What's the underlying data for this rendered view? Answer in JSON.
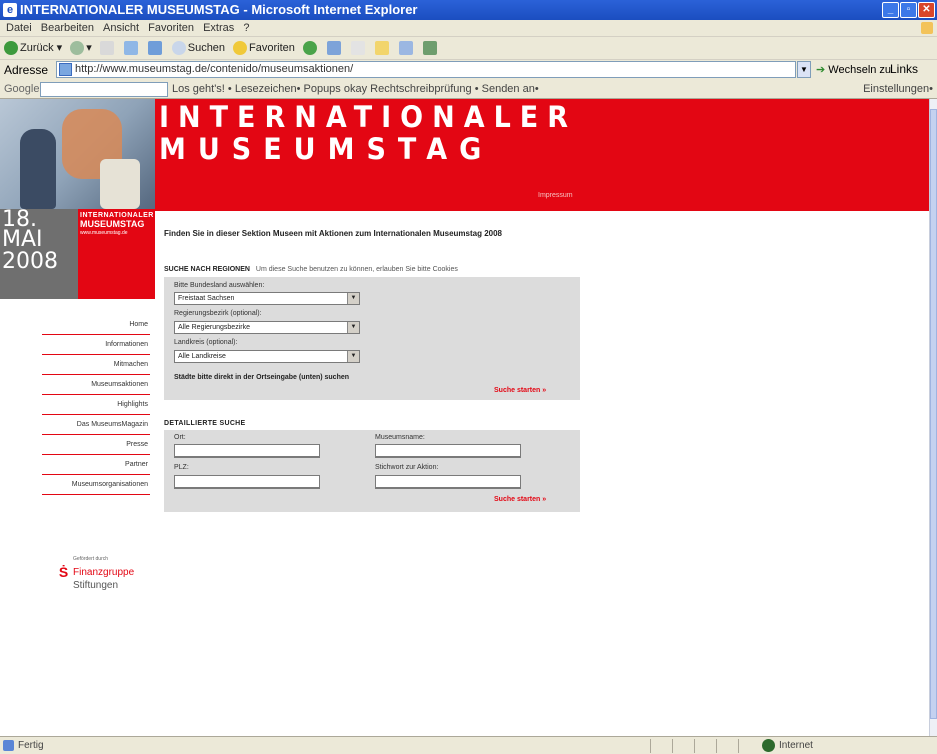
{
  "window": {
    "title": "INTERNATIONALER MUSEUMSTAG - Microsoft Internet Explorer",
    "buttons": [
      "_",
      "▫",
      "✕"
    ]
  },
  "menu": [
    "Datei",
    "Bearbeiten",
    "Ansicht",
    "Favoriten",
    "Extras",
    "?"
  ],
  "toolbar": {
    "back": "Zurück",
    "search": "Suchen",
    "favorites": "Favoriten"
  },
  "address": {
    "label": "Adresse",
    "url": "http://www.museumstag.de/contenido/museumsaktionen/",
    "go": "Wechseln zu",
    "links": "Links"
  },
  "googlebar": {
    "logo": "Google G•",
    "items": "Los geht's! • Lesezeichen• Popups okay Rechtschreibprüfung • Senden an•",
    "settings": "Einstellungen•"
  },
  "header": {
    "line1": "INTERNATIONALER",
    "line2": "MUSEUMSTAG",
    "impressum": "Impressum",
    "date": [
      "18.",
      "MAI",
      "2008"
    ],
    "mini_logo": [
      "INTERNATIONALER",
      "MUSEUMSTAG",
      "www.museumstag.de"
    ]
  },
  "nav": [
    "Home",
    "Informationen",
    "Mitmachen",
    "Museumsaktionen",
    "Highlights",
    "Das MuseumsMagazin",
    "Presse",
    "Partner",
    "Museumsorganisationen"
  ],
  "sponsor": {
    "label": "Gefördert durch",
    "icon": "Ṡ",
    "line1": "Finanzgruppe",
    "line2": "Stiftungen"
  },
  "content": {
    "intro": "Finden Sie in dieser Sektion Museen mit Aktionen zum Internationalen Museumstag 2008",
    "regions": {
      "heading": "SUCHE NACH REGIONEN",
      "notice": "Um diese Suche benutzen zu können, erlauben Sie bitte Cookies",
      "bundesland_label": "Bitte Bundesland auswählen:",
      "bundesland_value": "Freistaat Sachsen",
      "bezirk_label": "Regierungsbezirk (optional):",
      "bezirk_value": "Alle Regierungsbezirke",
      "kreis_label": "Landkreis (optional):",
      "kreis_value": "Alle Landkreise",
      "note": "Städte bitte direkt in der Ortseingabe (unten) suchen",
      "start": "Suche starten »"
    },
    "detail": {
      "heading": "DETAILLIERTE SUCHE",
      "ort_label": "Ort:",
      "plz_label": "PLZ:",
      "museum_label": "Museumsname:",
      "keyword_label": "Stichwort zur Aktion:",
      "start": "Suche starten »"
    }
  },
  "status": {
    "left": "Fertig",
    "zone": "Internet"
  }
}
